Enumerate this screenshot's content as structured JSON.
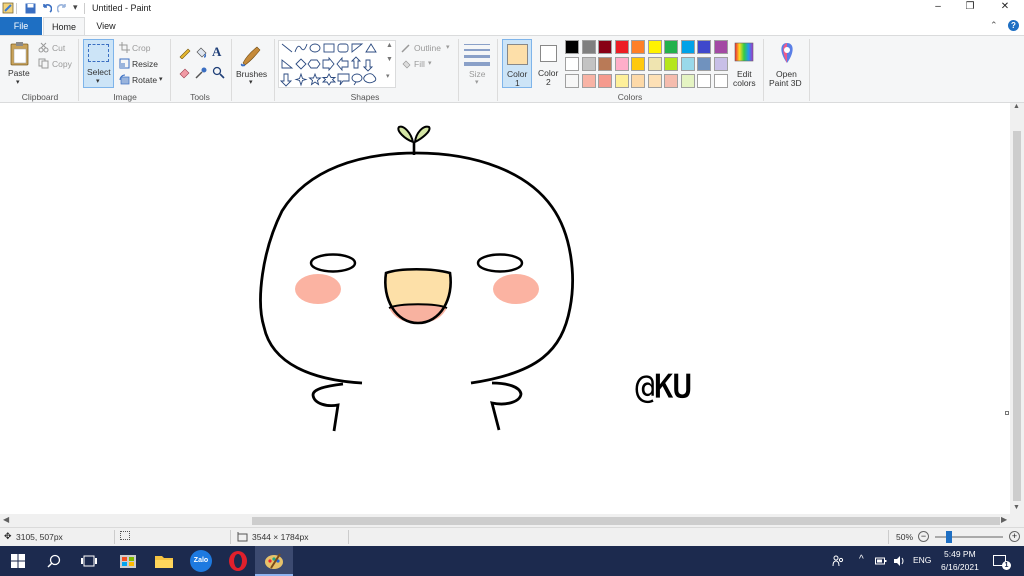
{
  "window": {
    "title": "Untitled - Paint",
    "controls": {
      "minimize": "–",
      "restore": "❐",
      "close": "✕"
    }
  },
  "tabs": {
    "file": "File",
    "home": "Home",
    "view": "View"
  },
  "ribbon": {
    "clipboard": {
      "paste": "Paste",
      "cut": "Cut",
      "copy": "Copy",
      "label": "Clipboard"
    },
    "image": {
      "select": "Select",
      "crop": "Crop",
      "resize": "Resize",
      "rotate": "Rotate",
      "label": "Image"
    },
    "tools": {
      "label": "Tools"
    },
    "brushes": {
      "label": "Brushes"
    },
    "shapes": {
      "outline": "Outline",
      "fill": "Fill",
      "label": "Shapes"
    },
    "size": {
      "label": "Size"
    },
    "color1": {
      "label": "Color",
      "num": "1",
      "value": "#fddfa9"
    },
    "color2": {
      "label": "Color",
      "num": "2",
      "value": "#ffffff"
    },
    "colors_label": "Colors",
    "edit_colors": {
      "line1": "Edit",
      "line2": "colors"
    },
    "paint3d": {
      "line1": "Open",
      "line2": "Paint 3D"
    },
    "palette": [
      "#000000",
      "#7f7f7f",
      "#880015",
      "#ed1c24",
      "#ff7f27",
      "#fff200",
      "#22b14c",
      "#00a2e8",
      "#3f48cc",
      "#a349a4",
      "#ffffff",
      "#c3c3c3",
      "#b97a57",
      "#ffaec9",
      "#ffc90e",
      "#efe4b0",
      "#b5e61d",
      "#99d9ea",
      "#7092be",
      "#c8bfe7",
      "#f7f7f7",
      "#f8b3a5",
      "#f59a8e",
      "#fef09a",
      "#fdd9a8",
      "#fde0b6",
      "#f5bcae",
      "#e5f4c3",
      "#ffffff",
      "#ffffff"
    ]
  },
  "canvas": {
    "watermark": "@KU",
    "colors": {
      "blush": "#fbb3a2",
      "mouth": "#fde0a8",
      "tongue": "#f8b2a0",
      "sprout": "#d5e6a5"
    }
  },
  "status": {
    "cursor_pos": "3105, 507px",
    "image_size": "3544 × 1784px",
    "zoom": "50%",
    "zoom_fraction": 0.18
  },
  "taskbar": {
    "lang": "ENG",
    "time": "5:49 PM",
    "date": "6/16/2021",
    "notif_count": "1",
    "zalo": "Zalo"
  }
}
